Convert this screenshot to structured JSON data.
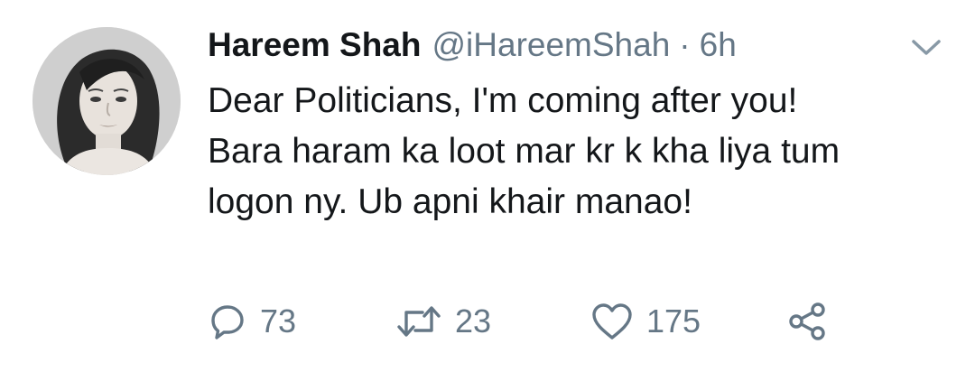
{
  "tweet": {
    "author_name": "Hareem Shah",
    "handle": "@iHareemShah",
    "separator": "·",
    "time": "6h",
    "text_lines": [
      "Dear Politicians, I'm coming after you!",
      "Bara haram ka loot mar kr k kha liya tum",
      "logon ny. Ub apni khair manao!"
    ],
    "actions": {
      "reply_count": "73",
      "retweet_count": "23",
      "like_count": "175"
    }
  },
  "icons": {
    "reply": "reply-icon",
    "retweet": "retweet-icon",
    "like": "heart-icon",
    "share": "share-icon",
    "menu": "chevron-down-icon"
  },
  "colors": {
    "text_primary": "#14171a",
    "text_secondary": "#657786"
  }
}
